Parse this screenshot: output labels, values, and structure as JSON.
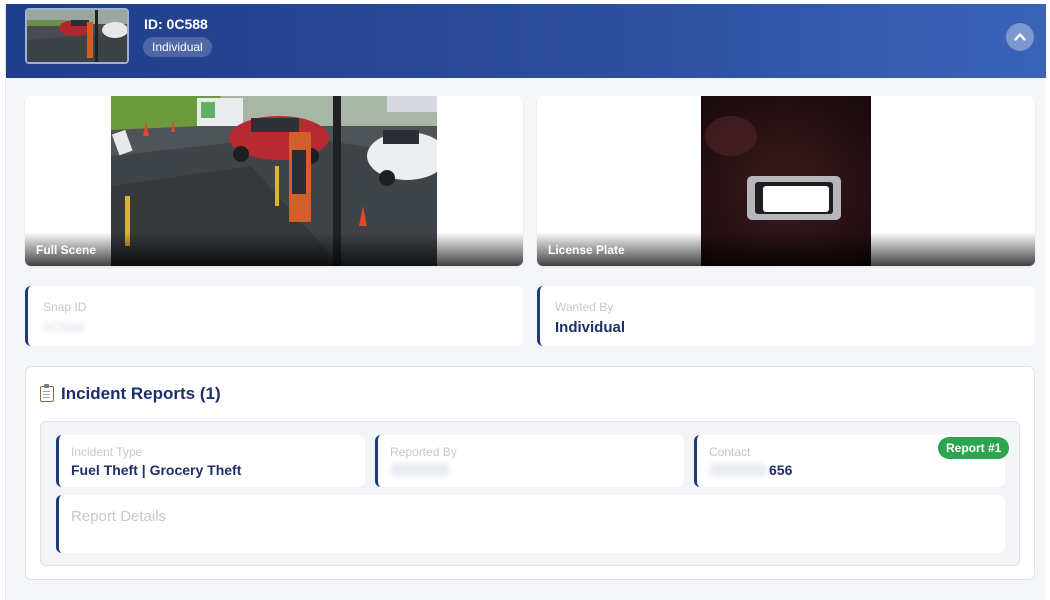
{
  "header": {
    "id_title": "ID: 0C588",
    "type_badge": "Individual",
    "thumbnail": "full-scene-thumbnail"
  },
  "media": {
    "full_scene_caption": "Full Scene",
    "license_plate_caption": "License Plate"
  },
  "info": {
    "snap_id_label": "Snap ID",
    "snap_id_value": "0C588",
    "wanted_by_label": "Wanted By",
    "wanted_by_value": "Individual"
  },
  "incidents": {
    "title": "Incident Reports (1)",
    "report_badge": "Report #1",
    "incident_type_label": "Incident Type",
    "incident_type_value": "Fuel Theft | Grocery Theft",
    "reported_by_label": "Reported By",
    "contact_label": "Contact",
    "contact_value_visible": "656",
    "details_label": "Report Details"
  },
  "icons": {
    "collapse": "chevron-up-icon",
    "incident_title": "clipboard-icon"
  },
  "colors": {
    "header_start": "#1f3d8a",
    "header_end": "#3a63b8",
    "accent_text": "#1d2f6b",
    "badge_green": "#2ea44f"
  }
}
